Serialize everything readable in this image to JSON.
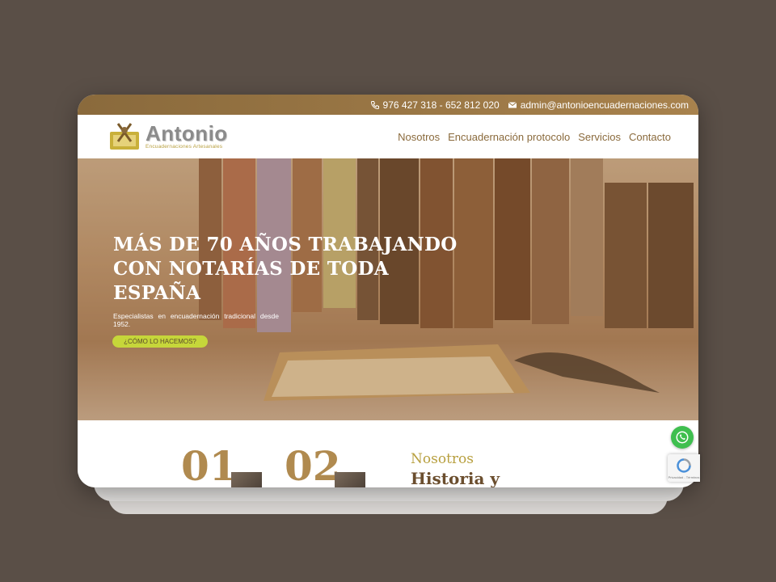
{
  "topbar": {
    "phone": "976 427 318 - 652 812 020",
    "email": "admin@antonioencuadernaciones.com"
  },
  "logo": {
    "name": "Antonio",
    "tagline": "Encuadernaciones Artesanales"
  },
  "nav": {
    "items": [
      "Nosotros",
      "Encuadernación protocolo",
      "Servicios",
      "Contacto"
    ]
  },
  "hero": {
    "title": "MÁS DE 70 AÑOS TRABAJANDO CON NOTARÍAS DE TODA ESPAÑA",
    "text": "Especialistas en encuadernación tradicional desde 1952.",
    "button": "¿CÓMO LO HACEMOS?"
  },
  "section": {
    "num1": "01",
    "num2": "02",
    "label": "Nosotros",
    "title": "Historia y"
  },
  "widgets": {
    "recaptcha_label": "Privacidad - Términos"
  },
  "colors": {
    "brand_brown": "#8a6a3c",
    "accent_gold": "#b08a4f",
    "accent_lime": "#c6d63a",
    "whatsapp_green": "#3fbf4f"
  }
}
